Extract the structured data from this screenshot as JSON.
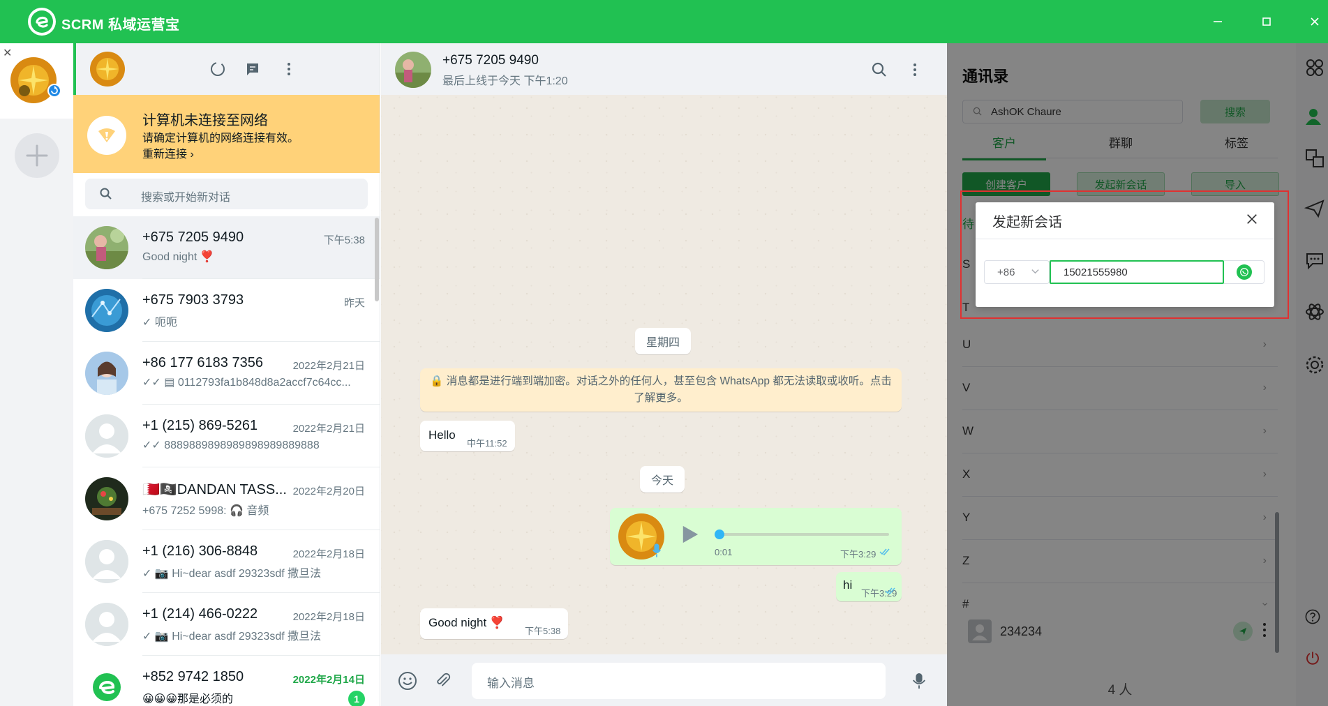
{
  "app": {
    "title": "SCRM 私域运营宝"
  },
  "chat_list": {
    "search_placeholder": "搜索或开始新对话",
    "network_warning": {
      "title": "计算机未连接至网络",
      "subtitle": "请确定计算机的网络连接有效。",
      "reconnect": "重新连接 ›"
    },
    "chats": [
      {
        "name": "+675 7205 9490",
        "time": "下午5:38",
        "message": "Good night ❣️"
      },
      {
        "name": "+675 7903 3793",
        "time": "昨天",
        "message": "✓ 呃呃"
      },
      {
        "name": "+86 177 6183 7356",
        "time": "2022年2月21日",
        "message": "✓✓ ▤ 0112793fa1b848d8a2accf7c64cc..."
      },
      {
        "name": "+1 (215) 869-5261",
        "time": "2022年2月21日",
        "message": "✓✓ 8889889898989898989889888"
      },
      {
        "name": "🇧🇭🏴‍☠️DANDAN TASS...",
        "time": "2022年2月20日",
        "message": "+675 7252 5998: 🎧 音频"
      },
      {
        "name": "+1 (216) 306-8848",
        "time": "2022年2月18日",
        "message": "✓ 📷 Hi~dear asdf 29323sdf 撒旦法"
      },
      {
        "name": "+1 (214) 466-0222",
        "time": "2022年2月18日",
        "message": "✓ 📷 Hi~dear asdf 29323sdf 撒旦法"
      },
      {
        "name": "+852 9742 1850",
        "time": "2022年2月14日",
        "message": "😀😀😀那是必须的",
        "unread": "1"
      }
    ]
  },
  "conversation": {
    "contact_name": "+675 7205 9490",
    "status": "最后上线于今天 下午1:20",
    "day_thursday": "星期四",
    "encryption_notice": "🔒 消息都是进行端到端加密。对话之外的任何人，甚至包含 WhatsApp 都无法读取或收听。点击了解更多。",
    "msg_hello": {
      "text": "Hello",
      "time": "中午11:52"
    },
    "day_today": "今天",
    "voice": {
      "duration": "0:01",
      "time": "下午3:29",
      "progress": 0.0
    },
    "msg_hi": {
      "text": "hi",
      "time": "下午3:29"
    },
    "msg_goodnight": {
      "text": "Good night ❣️",
      "time": "下午5:38"
    },
    "input_placeholder": "输入消息"
  },
  "contacts": {
    "title": "通讯录",
    "search_value": "AshOK Chaure",
    "search_button": "搜索",
    "tabs": [
      "客户",
      "群聊",
      "标签"
    ],
    "buttons": {
      "create": "创建客户",
      "new_chat": "发起新会话",
      "import": "导入"
    },
    "partial_letter": "待",
    "letters": [
      "S",
      "T",
      "U",
      "V",
      "W",
      "X",
      "Y",
      "Z",
      "#"
    ],
    "contact": {
      "name": "234234"
    },
    "count": "4 人"
  },
  "dialog": {
    "title": "发起新会话",
    "country_code": "+86",
    "phone": "15021555980"
  },
  "colors": {
    "brand": "#21c152",
    "highlight": "#e03131",
    "warning_bg": "#ffd279"
  }
}
